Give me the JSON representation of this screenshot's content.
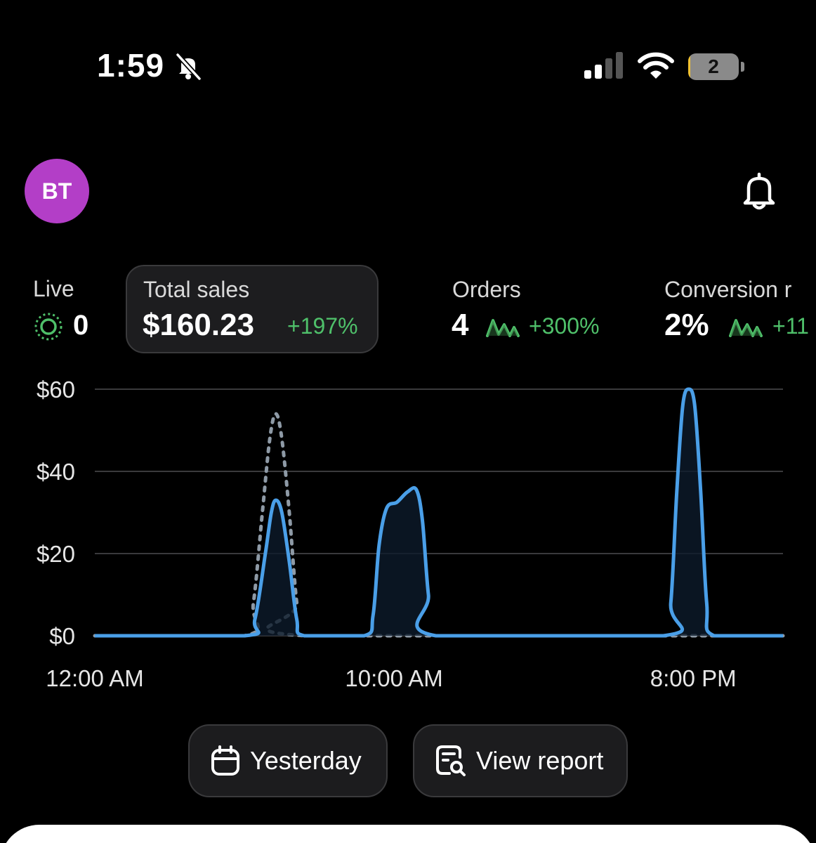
{
  "status_bar": {
    "time": "1:59",
    "battery_level": "2",
    "battery_fraction": 0.04,
    "icons": [
      "bell-slash-icon",
      "cellular-signal-icon",
      "wifi-icon",
      "battery-icon"
    ]
  },
  "header": {
    "avatar_initials": "BT",
    "avatar_color": "#b33ec7",
    "notification_icon": "bell-icon"
  },
  "metrics": {
    "live": {
      "label": "Live",
      "value": "0"
    },
    "total_sales": {
      "label": "Total sales",
      "value": "$160.23",
      "change": "+197%"
    },
    "orders": {
      "label": "Orders",
      "value": "4",
      "change": "+300%"
    },
    "conversion": {
      "label": "Conversion r",
      "value": "2%",
      "change": "+11"
    }
  },
  "colors": {
    "accent_green": "#4fc06a",
    "series_blue": "#4a9fe8",
    "comparison_gray": "#8e9aa6"
  },
  "chart_data": {
    "type": "line",
    "y_tick_labels": [
      "$60",
      "$40",
      "$20",
      "$0"
    ],
    "x_tick_labels": [
      "12:00 AM",
      "10:00 AM",
      "8:00 PM"
    ],
    "ylim": [
      0,
      60
    ],
    "x_unit": "hour of day",
    "grid": true,
    "series": [
      {
        "style": "solid",
        "points": [
          [
            0,
            0
          ],
          [
            5.0,
            0
          ],
          [
            5.35,
            4
          ],
          [
            5.7,
            20
          ],
          [
            5.9,
            30
          ],
          [
            6.05,
            33
          ],
          [
            6.25,
            30
          ],
          [
            6.5,
            18
          ],
          [
            6.75,
            4
          ],
          [
            7.0,
            0
          ],
          [
            9.0,
            0
          ],
          [
            9.3,
            5
          ],
          [
            9.5,
            22
          ],
          [
            9.75,
            31
          ],
          [
            10.1,
            32.5
          ],
          [
            10.45,
            35
          ],
          [
            10.75,
            35.5
          ],
          [
            10.95,
            28
          ],
          [
            11.15,
            10
          ],
          [
            11.4,
            0
          ],
          [
            19.0,
            0
          ],
          [
            19.25,
            8
          ],
          [
            19.45,
            35
          ],
          [
            19.65,
            56
          ],
          [
            19.85,
            60
          ],
          [
            20.05,
            56
          ],
          [
            20.25,
            35
          ],
          [
            20.45,
            8
          ],
          [
            20.7,
            0
          ],
          [
            23.0,
            0
          ]
        ]
      },
      {
        "style": "dotted",
        "points": [
          [
            0,
            0
          ],
          [
            5.0,
            0
          ],
          [
            5.3,
            8
          ],
          [
            5.6,
            30
          ],
          [
            5.85,
            48
          ],
          [
            6.05,
            54
          ],
          [
            6.25,
            48
          ],
          [
            6.5,
            30
          ],
          [
            6.75,
            8
          ],
          [
            7.0,
            0
          ],
          [
            23.0,
            0
          ]
        ]
      }
    ]
  },
  "actions": {
    "yesterday_label": "Yesterday",
    "view_report_label": "View report"
  }
}
